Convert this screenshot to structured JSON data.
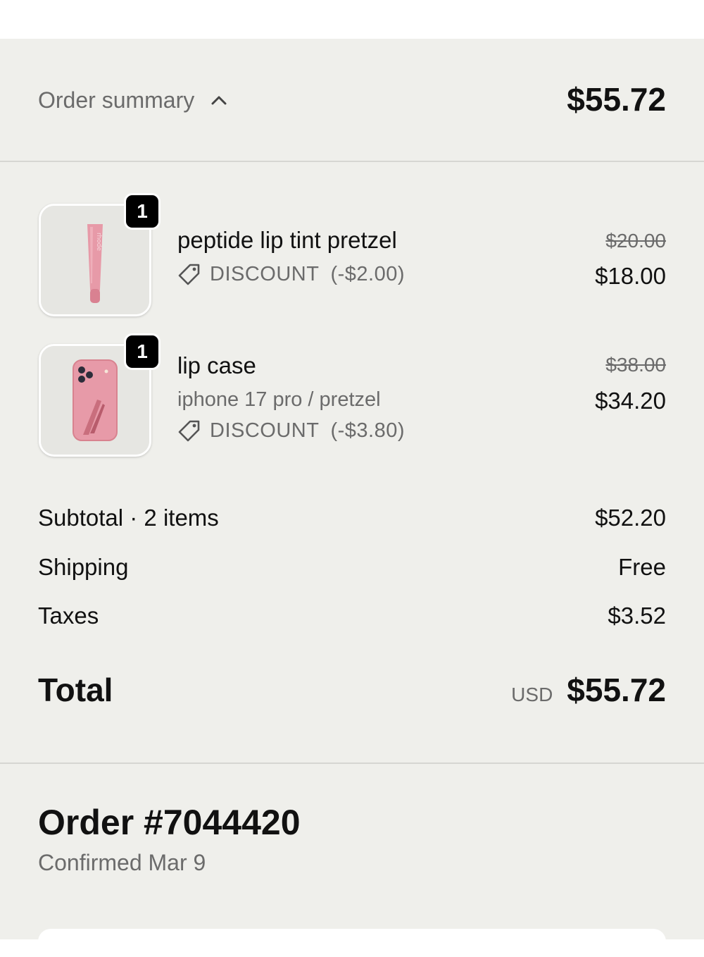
{
  "summary": {
    "label": "Order summary",
    "total": "$55.72",
    "toggle_icon": "chevron-up-icon"
  },
  "items": [
    {
      "quantity": "1",
      "name": "peptide lip tint pretzel",
      "variant": "",
      "discount_label": "DISCOUNT",
      "discount_amount": "(-$2.00)",
      "original_price": "$20.00",
      "price": "$18.00",
      "image_icon": "lip-tint-tube-image",
      "image_wordmark": "rhode"
    },
    {
      "quantity": "1",
      "name": "lip case",
      "variant": "iphone 17 pro / pretzel",
      "discount_label": "DISCOUNT",
      "discount_amount": "(-$3.80)",
      "original_price": "$38.00",
      "price": "$34.20",
      "image_icon": "phone-case-image"
    }
  ],
  "totals": {
    "subtotal_label": "Subtotal · 2 items",
    "subtotal_value": "$52.20",
    "shipping_label": "Shipping",
    "shipping_value": "Free",
    "taxes_label": "Taxes",
    "taxes_value": "$3.52",
    "total_label": "Total",
    "currency": "USD",
    "total_value": "$55.72"
  },
  "order": {
    "title": "Order #7044420",
    "confirmed": "Confirmed Mar 9"
  },
  "colors": {
    "panel_bg": "#efefeb",
    "product_pink": "#e79aa8",
    "muted_text": "#6b6b6b"
  }
}
